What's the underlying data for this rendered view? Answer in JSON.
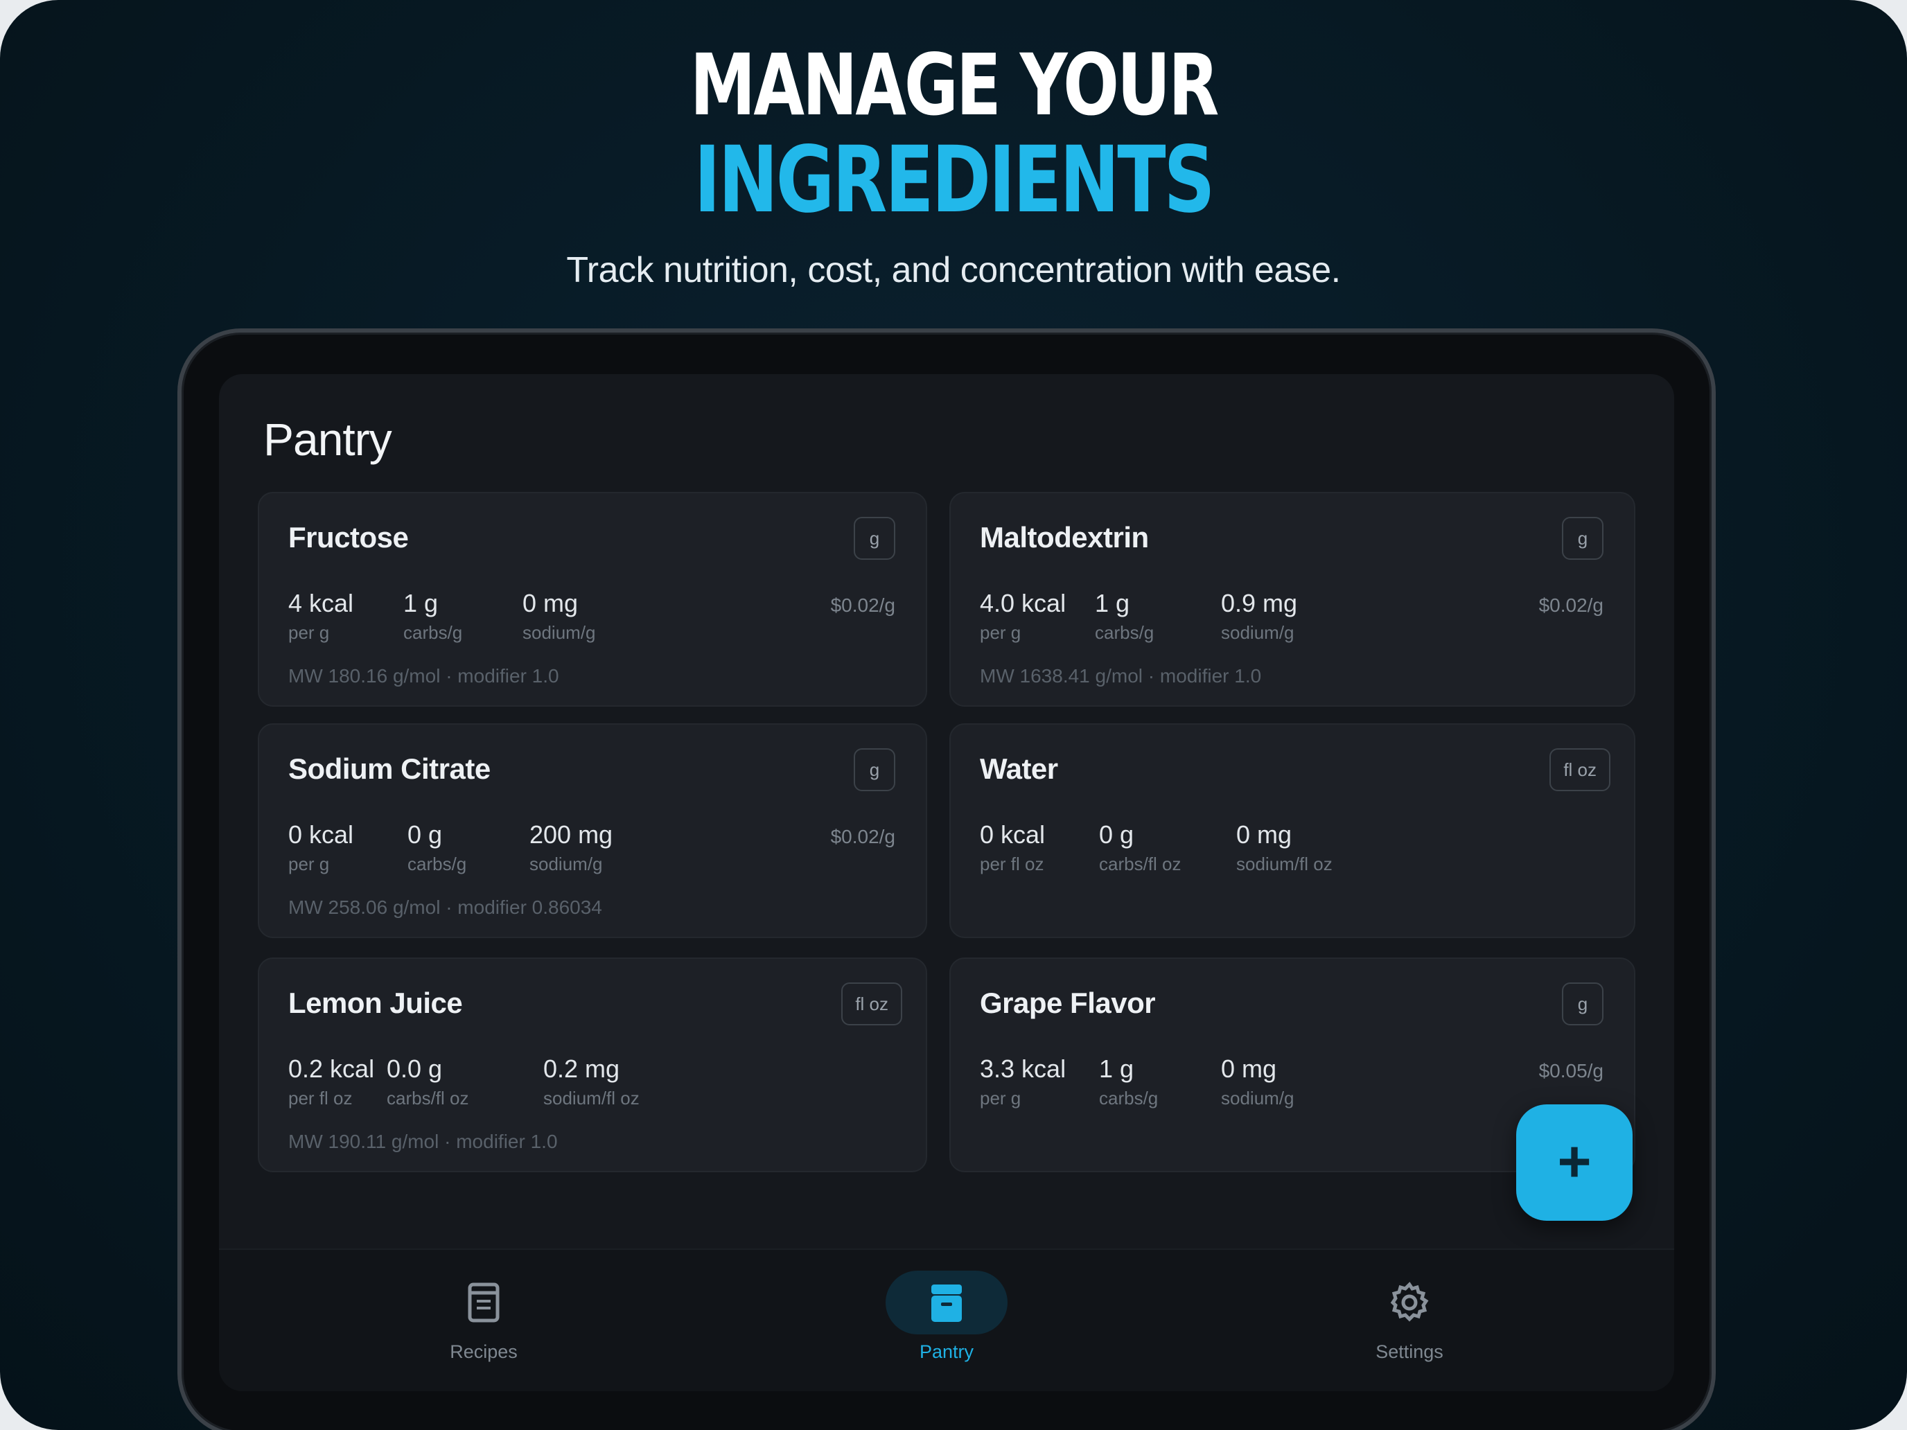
{
  "hero": {
    "headline_line1": "MANAGE YOUR",
    "headline_line2": "INGREDIENTS",
    "subtitle": "Track nutrition, cost, and concentration with ease."
  },
  "colors": {
    "accent": "#1fb1e4",
    "background": "#071923",
    "surface": "#15181d",
    "card": "#1d2026"
  },
  "screen": {
    "title": "Pantry"
  },
  "ingredients": [
    {
      "name": "Fructose",
      "unit": "g",
      "kcal": "4 kcal",
      "kcal_label": "per g",
      "carbs": "1 g",
      "carbs_label": "carbs/g",
      "sodium": "0 mg",
      "sodium_label": "sodium/g",
      "price": "$0.02/g",
      "meta": "MW 180.16 g/mol · modifier 1.0"
    },
    {
      "name": "Maltodextrin",
      "unit": "g",
      "kcal": "4.0 kcal",
      "kcal_label": "per g",
      "carbs": "1 g",
      "carbs_label": "carbs/g",
      "sodium": "0.9 mg",
      "sodium_label": "sodium/g",
      "price": "$0.02/g",
      "meta": "MW 1638.41 g/mol · modifier 1.0"
    },
    {
      "name": "Sodium Citrate",
      "unit": "g",
      "kcal": "0 kcal",
      "kcal_label": "per g",
      "carbs": "0 g",
      "carbs_label": "carbs/g",
      "sodium": "200 mg",
      "sodium_label": "sodium/g",
      "price": "$0.02/g",
      "meta": "MW 258.06 g/mol · modifier 0.86034"
    },
    {
      "name": "Water",
      "unit": "fl oz",
      "kcal": "0 kcal",
      "kcal_label": "per fl oz",
      "carbs": "0 g",
      "carbs_label": "carbs/fl oz",
      "sodium": "0 mg",
      "sodium_label": "sodium/fl oz",
      "price": "",
      "meta": ""
    },
    {
      "name": "Lemon Juice",
      "unit": "fl oz",
      "kcal": "0.2 kcal",
      "kcal_label": "per fl oz",
      "carbs": "0.0 g",
      "carbs_label": "carbs/fl oz",
      "sodium": "0.2 mg",
      "sodium_label": "sodium/fl oz",
      "price": "",
      "meta": "MW 190.11 g/mol · modifier 1.0"
    },
    {
      "name": "Grape Flavor",
      "unit": "g",
      "kcal": "3.3 kcal",
      "kcal_label": "per g",
      "carbs": "1 g",
      "carbs_label": "carbs/g",
      "sodium": "0 mg",
      "sodium_label": "sodium/g",
      "price": "$0.05/g",
      "meta": ""
    }
  ],
  "fab": {
    "label": "+",
    "icon": "plus-icon"
  },
  "tabs": [
    {
      "label": "Recipes",
      "icon": "recipe-icon",
      "active": false
    },
    {
      "label": "Pantry",
      "icon": "pantry-icon",
      "active": true
    },
    {
      "label": "Settings",
      "icon": "gear-icon",
      "active": false
    }
  ]
}
